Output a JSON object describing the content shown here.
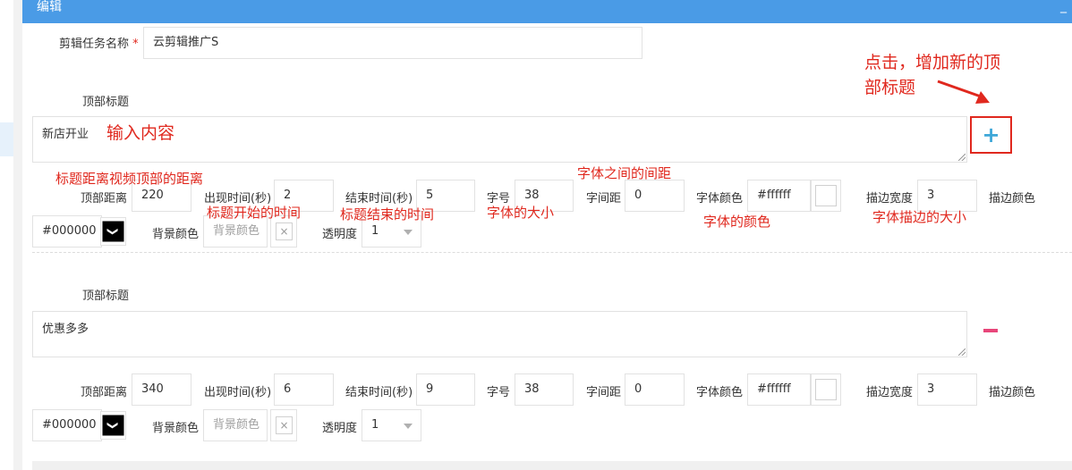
{
  "window": {
    "title": "编辑",
    "minimize_glyph": "_"
  },
  "task_name": {
    "label": "剪辑任务名称",
    "required_mark": "*",
    "value": "云剪辑推广S"
  },
  "common": {
    "bg_color_placeholder": "背景颜色",
    "clear_glyph": "×",
    "dropdown_glyph": "❯"
  },
  "labels": {
    "top_title": "顶部标题",
    "top_distance": "顶部距离",
    "start_time": "出现时间(秒)",
    "end_time": "结束时间(秒)",
    "font_size": "字号",
    "letter_spacing": "字间距",
    "font_color": "字体颜色",
    "stroke_width": "描边宽度",
    "stroke_color": "描边颜色",
    "bg_color": "背景颜色",
    "opacity": "透明度"
  },
  "titles": [
    {
      "text": "新店开业",
      "top_distance": "220",
      "start_time": "2",
      "end_time": "5",
      "font_size": "38",
      "letter_spacing": "0",
      "font_color": "#ffffff",
      "stroke_width": "3",
      "stroke_color": "#000000",
      "opacity": "1",
      "action": "add"
    },
    {
      "text": "优惠多多",
      "top_distance": "340",
      "start_time": "6",
      "end_time": "9",
      "font_size": "38",
      "letter_spacing": "0",
      "font_color": "#ffffff",
      "stroke_width": "3",
      "stroke_color": "#000000",
      "opacity": "1",
      "action": "remove"
    }
  ],
  "annotations": {
    "add_hint_line1": "点击，增加新的顶",
    "add_hint_line2": "部标题",
    "input_content": "输入内容",
    "top_distance": "标题距离视频顶部的距离",
    "start_time": "标题开始的时间",
    "end_time": "标题结束的时间",
    "font_size": "字体的大小",
    "letter_spacing": "字体之间的间距",
    "font_color": "字体的颜色",
    "stroke_width": "字体描边的大小"
  },
  "colors": {
    "titlebar": "#4a9be6",
    "annotation": "#e0281e",
    "add_icon": "#3ea7d8",
    "remove_icon": "#e8457a"
  }
}
